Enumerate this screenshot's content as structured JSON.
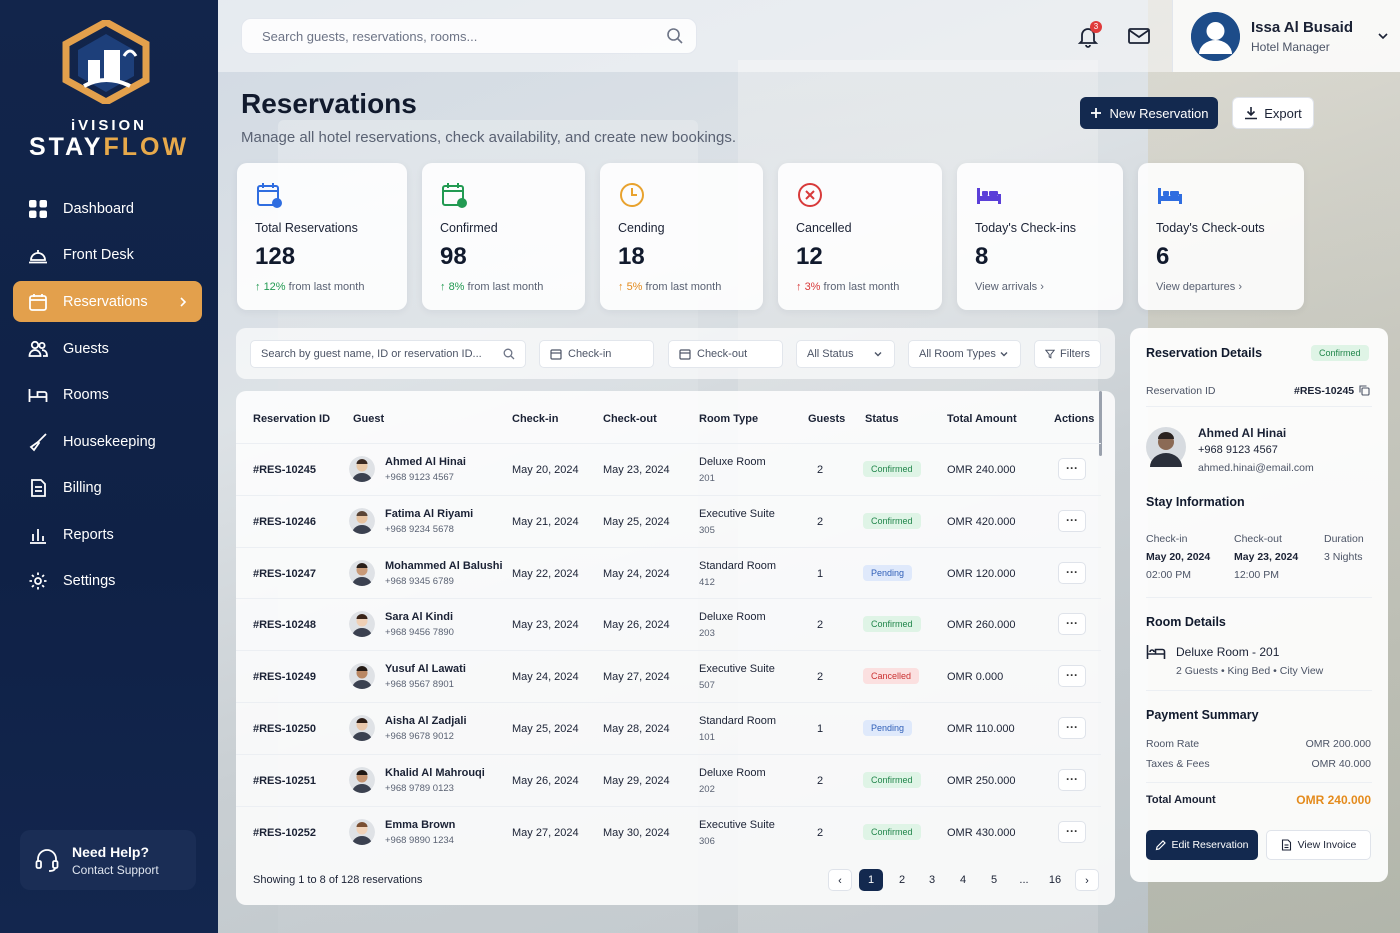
{
  "brand": {
    "line1": "iVISION",
    "line2a": "STAY",
    "line2b": "FLOW"
  },
  "colors": {
    "navy": "#13294f",
    "accent": "#e3a04c",
    "green": "#229a52",
    "red": "#d83a3a"
  },
  "sidebar": {
    "items": [
      {
        "label": "Dashboard",
        "icon": "grid-icon"
      },
      {
        "label": "Front Desk",
        "icon": "bell-desk-icon"
      },
      {
        "label": "Reservations",
        "icon": "calendar-icon",
        "active": true
      },
      {
        "label": "Guests",
        "icon": "users-icon"
      },
      {
        "label": "Rooms",
        "icon": "bed-icon"
      },
      {
        "label": "Housekeeping",
        "icon": "broom-icon"
      },
      {
        "label": "Billing",
        "icon": "receipt-icon"
      },
      {
        "label": "Reports",
        "icon": "bar-chart-icon"
      },
      {
        "label": "Settings",
        "icon": "gear-icon"
      }
    ],
    "help": {
      "title": "Need Help?",
      "link": "Contact Support"
    }
  },
  "topbar": {
    "search_placeholder": "Search guests, reservations, rooms...",
    "notif_count": "3",
    "user_name": "Issa Al Busaid",
    "user_role": "Hotel Manager"
  },
  "header": {
    "title": "Reservations",
    "subtitle": "Manage all hotel reservations, check availability, and create new bookings.",
    "new_label": "New Reservation",
    "export_label": "Export"
  },
  "stats": [
    {
      "label": "Total Reservations",
      "value": "128",
      "pct": "12%",
      "suffix": "from last month"
    },
    {
      "label": "Confirmed",
      "value": "98",
      "pct": "8%",
      "suffix": "from last month"
    },
    {
      "label": "Cending",
      "value": "18",
      "pct": "5%",
      "suffix": "from last month"
    },
    {
      "label": "Cancelled",
      "value": "12",
      "pct": "3%",
      "suffix": "from last month"
    },
    {
      "label": "Today's Check-ins",
      "value": "8",
      "link": "View arrivals"
    },
    {
      "label": "Today's Check-outs",
      "value": "6",
      "link": "View departures"
    }
  ],
  "filters": {
    "search_placeholder": "Search by guest name, ID or reservation ID...",
    "checkin": "Check-in",
    "checkout": "Check-out",
    "status": "All Status",
    "room_types": "All Room Types",
    "filters": "Filters"
  },
  "table": {
    "headers": [
      "Reservation ID",
      "Guest",
      "Check-in",
      "Check-out",
      "Room Type",
      "Guests",
      "Status",
      "Total Amount",
      "Actions"
    ],
    "rows": [
      {
        "id": "#RES-10245",
        "name": "Ahmed Al Hinai",
        "phone": "+968 9123 4567",
        "in": "May 20, 2024",
        "out": "May 23, 2024",
        "room": "Deluxe Room",
        "num": "201",
        "guests": "2",
        "status": "Confirmed",
        "amount": "OMR 240.000",
        "actions": "···"
      },
      {
        "id": "#RES-10246",
        "name": "Fatima Al Riyami",
        "phone": "+968 9234 5678",
        "in": "May 21, 2024",
        "out": "May 25, 2024",
        "room": "Executive Suite",
        "num": "305",
        "guests": "2",
        "status": "Confirmed",
        "amount": "OMR 420.000",
        "actions": "···"
      },
      {
        "id": "#RES-10247",
        "name": "Mohammed Al Balushi",
        "phone": "+968 9345 6789",
        "in": "May 22, 2024",
        "out": "May 24, 2024",
        "room": "Standard Room",
        "num": "412",
        "guests": "1",
        "status": "Pending",
        "amount": "OMR 120.000",
        "actions": "···"
      },
      {
        "id": "#RES-10248",
        "name": "Sara Al Kindi",
        "phone": "+968 9456 7890",
        "in": "May 23, 2024",
        "out": "May 26, 2024",
        "room": "Deluxe Room",
        "num": "203",
        "guests": "2",
        "status": "Confirmed",
        "amount": "OMR 260.000",
        "actions": "···"
      },
      {
        "id": "#RES-10249",
        "name": "Yusuf Al Lawati",
        "phone": "+968 9567 8901",
        "in": "May 24, 2024",
        "out": "May 27, 2024",
        "room": "Executive Suite",
        "num": "507",
        "guests": "2",
        "status": "Cancelled",
        "amount": "OMR 0.000",
        "actions": "···"
      },
      {
        "id": "#RES-10250",
        "name": "Aisha Al Zadjali",
        "phone": "+968 9678 9012",
        "in": "May 25, 2024",
        "out": "May 28, 2024",
        "room": "Standard Room",
        "num": "101",
        "guests": "1",
        "status": "Pending",
        "amount": "OMR 110.000",
        "actions": "···"
      },
      {
        "id": "#RES-10251",
        "name": "Khalid Al Mahrouqi",
        "phone": "+968 9789 0123",
        "in": "May 26, 2024",
        "out": "May 29, 2024",
        "room": "Deluxe Room",
        "num": "202",
        "guests": "2",
        "status": "Confirmed",
        "amount": "OMR 250.000",
        "actions": "···"
      },
      {
        "id": "#RES-10252",
        "name": "Emma Brown",
        "phone": "+968 9890 1234",
        "in": "May 27, 2024",
        "out": "May 30, 2024",
        "room": "Executive Suite",
        "num": "306",
        "guests": "2",
        "status": "Confirmed",
        "amount": "OMR 430.000",
        "actions": "···"
      }
    ],
    "showing": "Showing 1 to 8 of 128 reservations",
    "pages": [
      "1",
      "2",
      "3",
      "4",
      "5",
      "...",
      "16"
    ]
  },
  "details": {
    "title": "Reservation Details",
    "status": "Confirmed",
    "id_label": "Reservation ID",
    "id": "#RES-10245",
    "guest_name": "Ahmed Al Hinai",
    "guest_phone": "+968 9123 4567",
    "guest_email": "ahmed.hinai@email.com",
    "stay_title": "Stay Information",
    "checkin_label": "Check-in",
    "checkin_date": "May 20, 2024",
    "checkin_time": "02:00 PM",
    "checkout_label": "Check-out",
    "checkout_date": "May 23, 2024",
    "checkout_time": "12:00 PM",
    "duration_label": "Duration",
    "duration": "3 Nights",
    "room_title": "Room Details",
    "room_name": "Deluxe Room - 201",
    "room_guests": "2 Guests",
    "room_bed": "King Bed",
    "room_view": "City View",
    "pay_title": "Payment Summary",
    "rate_label": "Room Rate",
    "rate": "OMR 200.000",
    "tax_label": "Taxes & Fees",
    "tax": "OMR 40.000",
    "total_label": "Total Amount",
    "total": "OMR 240.000",
    "edit_label": "Edit Reservation",
    "invoice_label": "View Invoice"
  }
}
